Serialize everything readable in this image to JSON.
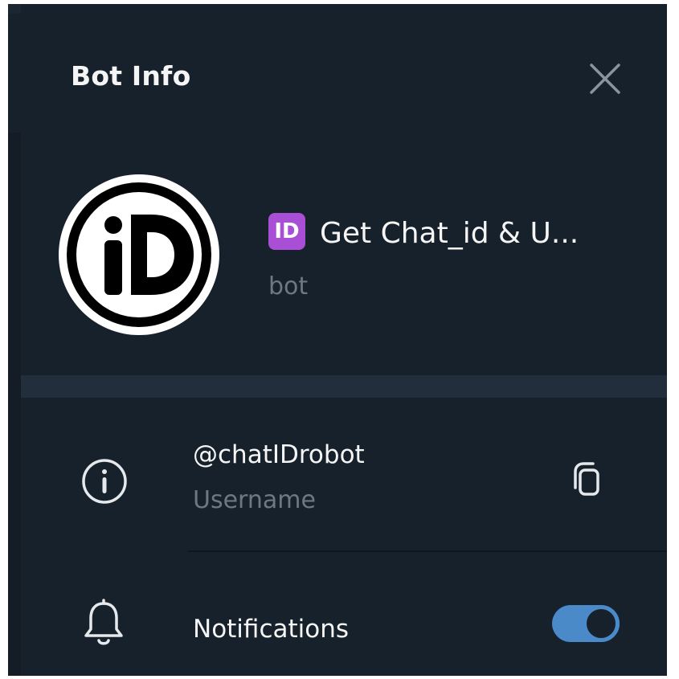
{
  "dialog": {
    "title": "Bot Info",
    "close_icon": "close-icon"
  },
  "profile": {
    "avatar_icon": "id-logo-avatar",
    "avatar_text": "iD",
    "emoji_text": "ID",
    "name": "Get Chat_id & U...",
    "subtitle": "bot"
  },
  "info": {
    "username_value": "@chatIDrobot",
    "username_label": "Username",
    "info_icon": "info-icon",
    "copy_icon": "copy-icon"
  },
  "notifications": {
    "label": "Notifications",
    "bell_icon": "bell-icon",
    "enabled": true
  },
  "colors": {
    "background": "#17212b",
    "divider": "#232e3c",
    "text_primary": "#f5f5f5",
    "text_secondary": "#6d7883",
    "accent": "#4b8ac9",
    "emoji_badge": "#a84fd6"
  }
}
